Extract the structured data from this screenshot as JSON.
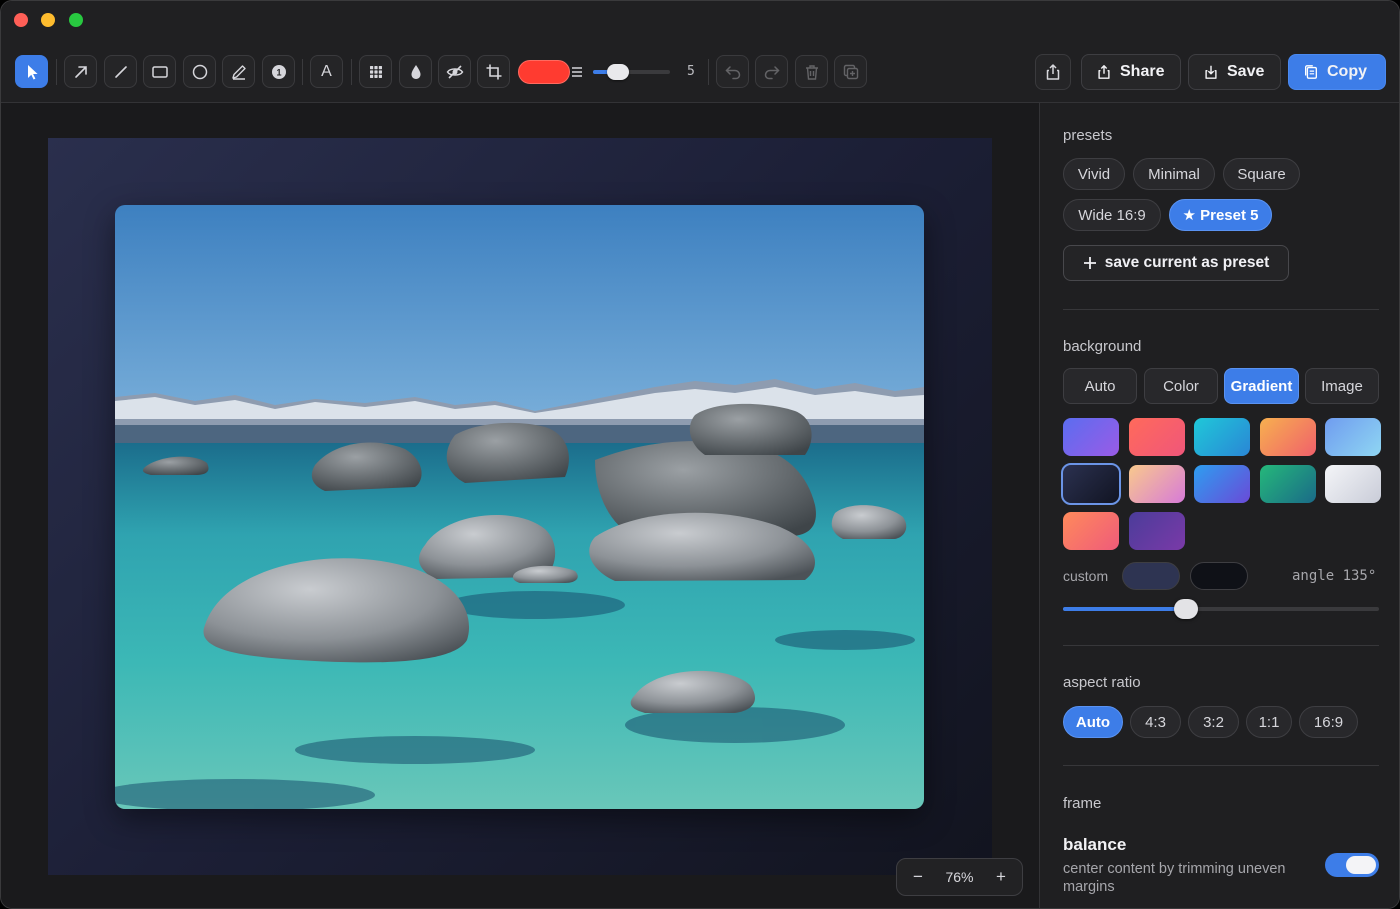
{
  "toolbar": {
    "tools": [
      "select-icon",
      "arrow-icon",
      "line-icon",
      "rectangle-icon",
      "ellipse-icon",
      "pen-icon",
      "counter-icon",
      "text-icon",
      "pixelate-icon",
      "blur-icon",
      "hide-icon",
      "crop-icon"
    ],
    "counter_label": "1",
    "text_tool_label": "A",
    "stroke_color": "#ff3b30",
    "stroke_size": "5",
    "stroke_size_fraction": 0.25,
    "share_label": "Share",
    "save_label": "Save",
    "copy_label": "Copy"
  },
  "canvas": {
    "zoom_value": "76%",
    "zoom_out": "−",
    "zoom_in": "+"
  },
  "panel": {
    "presets_title": "presets",
    "presets": [
      {
        "label": "Vivid",
        "selected": false
      },
      {
        "label": "Minimal",
        "selected": false
      },
      {
        "label": "Square",
        "selected": false
      },
      {
        "label": "Wide 16:9",
        "selected": false
      },
      {
        "label": "★ Preset 5",
        "selected": true
      }
    ],
    "save_preset_label": "save current as preset",
    "background_title": "background",
    "background_modes": [
      {
        "label": "Auto",
        "selected": false
      },
      {
        "label": "Color",
        "selected": false
      },
      {
        "label": "Gradient",
        "selected": true
      },
      {
        "label": "Image",
        "selected": false
      }
    ],
    "gradients": [
      [
        "#5b6df0",
        "#9a5be6"
      ],
      [
        "#ff6a5b",
        "#f0567a"
      ],
      [
        "#1fc8d8",
        "#2a86d6"
      ],
      [
        "#f7b04f",
        "#f0606b"
      ],
      [
        "#6f9cf0",
        "#8fd6f2"
      ],
      [
        "#2b3150",
        "#111422"
      ],
      [
        "#f9c98c",
        "#d77ad8"
      ],
      [
        "#2d9ef0",
        "#6a4ad8"
      ],
      [
        "#25b87a",
        "#1a6a88"
      ],
      [
        "#f4f5f8",
        "#c9ccd8"
      ],
      [
        "#ff8a5b",
        "#ef5b7a"
      ],
      [
        "#4b3c9a",
        "#7a3aa8"
      ]
    ],
    "selected_gradient_index": 5,
    "custom_label": "custom",
    "custom_color_1": "#2e3452",
    "custom_color_2": "#0f1117",
    "angle_label": "angle 135°",
    "angle_fraction": 0.38,
    "aspect_title": "aspect ratio",
    "aspect_options": [
      {
        "label": "Auto",
        "selected": true
      },
      {
        "label": "4:3",
        "selected": false
      },
      {
        "label": "3:2",
        "selected": false
      },
      {
        "label": "1:1",
        "selected": false
      },
      {
        "label": "16:9",
        "selected": false
      }
    ],
    "frame_title": "frame",
    "balance_title": "balance",
    "balance_desc": "center content by trimming uneven margins",
    "balance_enabled": true
  }
}
